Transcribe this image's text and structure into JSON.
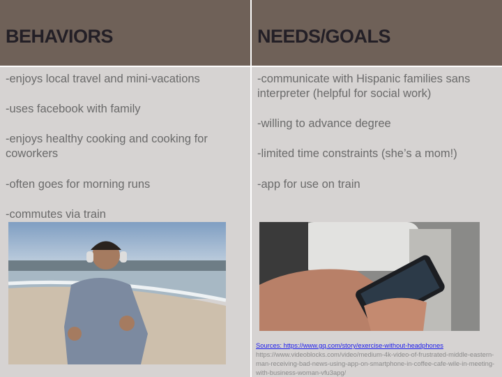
{
  "columns": [
    {
      "header": "BEHAVIORS",
      "items": [
        "-enjoys local travel and mini-vacations",
        "-uses facebook with family",
        "-enjoys healthy cooking and cooking for coworkers",
        "-often goes for morning runs",
        "-commutes via train"
      ]
    },
    {
      "header": "NEEDS/GOALS",
      "items": [
        "-communicate with Hispanic families sans interpreter (helpful for social work)",
        "-willing to advance degree",
        "-limited time constraints (she’s a mom!)",
        "-app for use on train"
      ]
    }
  ],
  "sources": {
    "link": "Sources: https://www.gq.com/story/exercise-without-headphones",
    "text": "https://www.videoblocks.com/video/medium-4k-video-of-frustrated-middle-eastern-man-receiving-bad-news-using-app-on-smartphone-in-coffee-cafe-wile-in-meeting-with-business-woman-vfu3apg/"
  },
  "colors": {
    "header": "#6f6158",
    "body": "#d6d3d2",
    "link": "#1a1aee"
  }
}
